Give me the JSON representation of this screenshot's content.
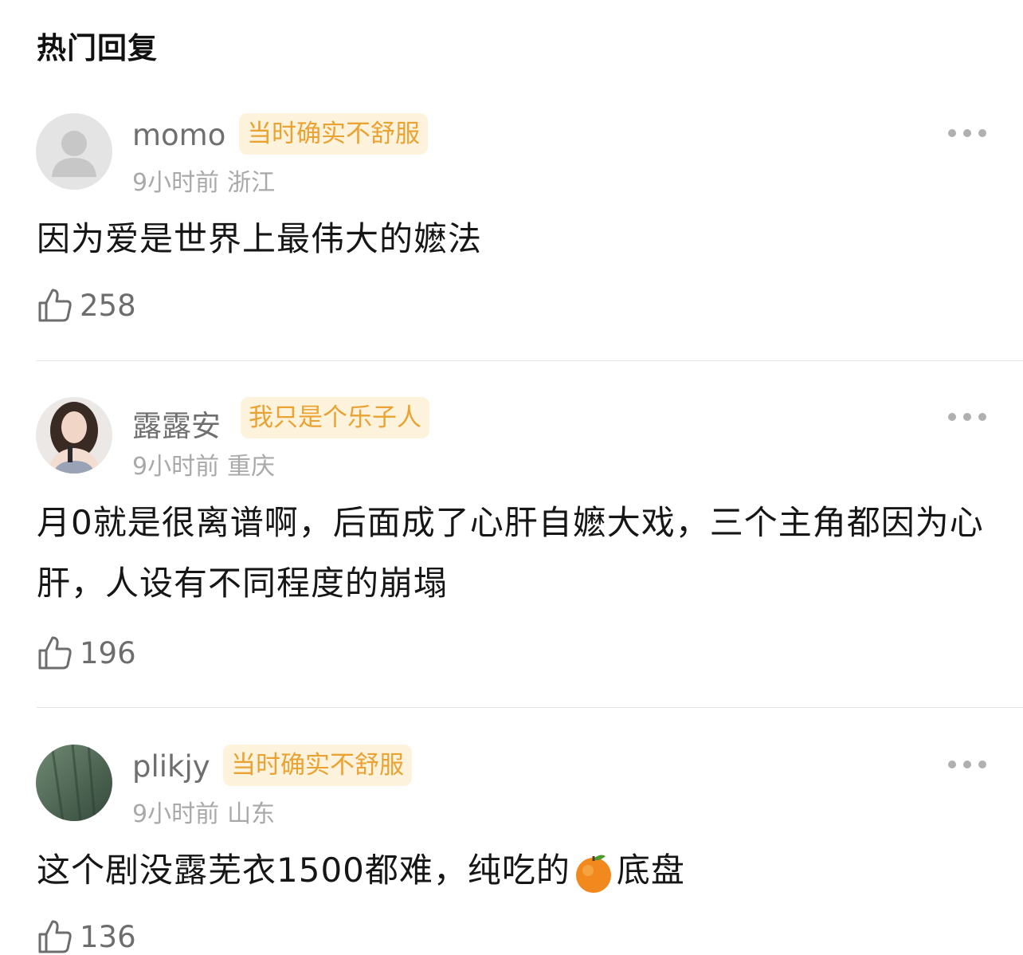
{
  "section_title": "热门回复",
  "comments": [
    {
      "username": "momo",
      "badge": "当时确实不舒服",
      "time": "9小时前",
      "location": "浙江",
      "text": "因为爱是世界上最伟大的嬷法",
      "likes": "258",
      "avatar": "default-avatar-icon"
    },
    {
      "username": "露露安",
      "badge": "我只是个乐子人",
      "time": "9小时前",
      "location": "重庆",
      "text": "月0就是很离谱啊，后面成了心肝自嬷大戏，三个主角都因为心肝，人设有不同程度的崩塌",
      "likes": "196",
      "avatar": "user-photo-avatar"
    },
    {
      "username": "plikjy",
      "badge": "当时确实不舒服",
      "time": "9小时前",
      "location": "山东",
      "text_before": "这个剧没露芜衣1500都难，纯吃的",
      "emoji": "orange-emoji",
      "text_after": "底盘",
      "likes": "136",
      "avatar": "green-texture-avatar"
    }
  ],
  "colors": {
    "badge_bg": "#fdf3dc",
    "badge_text": "#eaa232",
    "meta_text": "#a9a9a9",
    "username_text": "#6f6f6f"
  }
}
